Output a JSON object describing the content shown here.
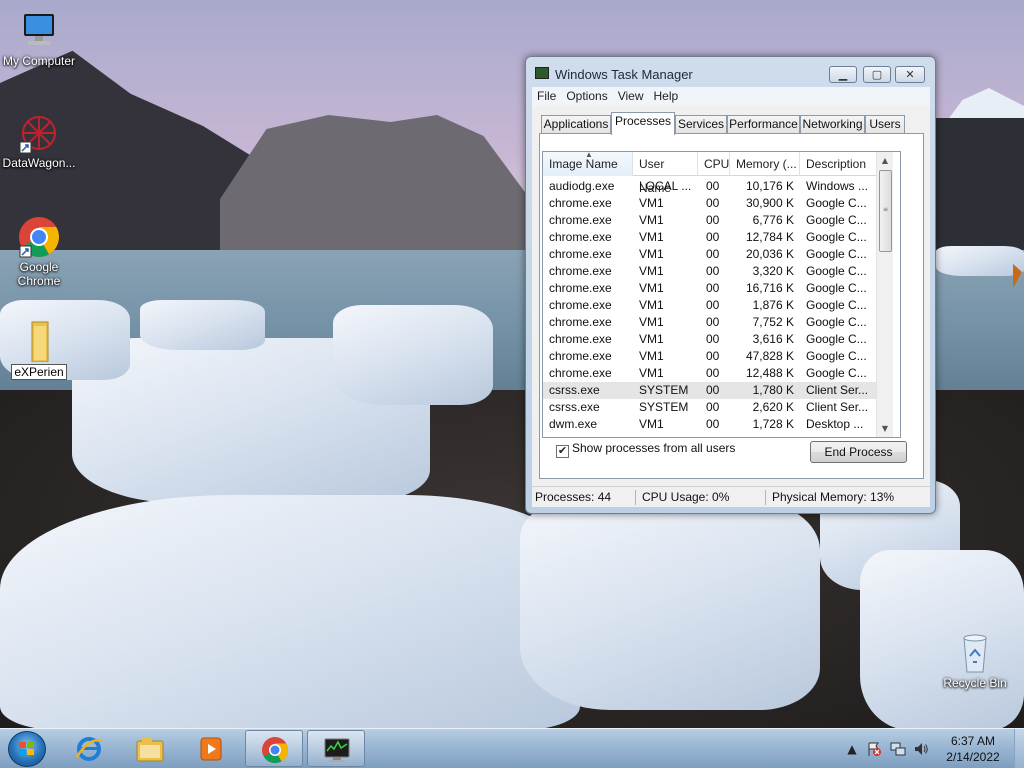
{
  "desktop": {
    "icons": [
      {
        "label": "My Computer",
        "icon": "computer-icon"
      },
      {
        "label": "DataWagon...",
        "icon": "datawagon-icon"
      },
      {
        "label": "Google Chrome",
        "icon": "chrome-icon"
      },
      {
        "label": "eXPerien",
        "icon": "folder-icon"
      },
      {
        "label": "Recycle Bin",
        "icon": "recycle-bin-icon"
      }
    ]
  },
  "window": {
    "title": "Windows Task Manager",
    "controls": {
      "minimize": "▁",
      "maximize": "▢",
      "close": "✕"
    },
    "menu": [
      "File",
      "Options",
      "View",
      "Help"
    ],
    "tabs": [
      "Applications",
      "Processes",
      "Services",
      "Performance",
      "Networking",
      "Users"
    ],
    "active_tab": "Processes",
    "columns": [
      "Image Name",
      "User Name",
      "CPU",
      "Memory (...",
      "Description"
    ],
    "processes": [
      {
        "name": "audiodg.exe",
        "user": "LOCAL ...",
        "cpu": "00",
        "memory": "10,176 K",
        "description": "Windows ..."
      },
      {
        "name": "chrome.exe",
        "user": "VM1",
        "cpu": "00",
        "memory": "30,900 K",
        "description": "Google C..."
      },
      {
        "name": "chrome.exe",
        "user": "VM1",
        "cpu": "00",
        "memory": "6,776 K",
        "description": "Google C..."
      },
      {
        "name": "chrome.exe",
        "user": "VM1",
        "cpu": "00",
        "memory": "12,784 K",
        "description": "Google C..."
      },
      {
        "name": "chrome.exe",
        "user": "VM1",
        "cpu": "00",
        "memory": "20,036 K",
        "description": "Google C..."
      },
      {
        "name": "chrome.exe",
        "user": "VM1",
        "cpu": "00",
        "memory": "3,320 K",
        "description": "Google C..."
      },
      {
        "name": "chrome.exe",
        "user": "VM1",
        "cpu": "00",
        "memory": "16,716 K",
        "description": "Google C..."
      },
      {
        "name": "chrome.exe",
        "user": "VM1",
        "cpu": "00",
        "memory": "1,876 K",
        "description": "Google C..."
      },
      {
        "name": "chrome.exe",
        "user": "VM1",
        "cpu": "00",
        "memory": "7,752 K",
        "description": "Google C..."
      },
      {
        "name": "chrome.exe",
        "user": "VM1",
        "cpu": "00",
        "memory": "3,616 K",
        "description": "Google C..."
      },
      {
        "name": "chrome.exe",
        "user": "VM1",
        "cpu": "00",
        "memory": "47,828 K",
        "description": "Google C..."
      },
      {
        "name": "chrome.exe",
        "user": "VM1",
        "cpu": "00",
        "memory": "12,488 K",
        "description": "Google C..."
      },
      {
        "name": "csrss.exe",
        "user": "SYSTEM",
        "cpu": "00",
        "memory": "1,780 K",
        "description": "Client Ser..."
      },
      {
        "name": "csrss.exe",
        "user": "SYSTEM",
        "cpu": "00",
        "memory": "2,620 K",
        "description": "Client Ser..."
      },
      {
        "name": "dwm.exe",
        "user": "VM1",
        "cpu": "00",
        "memory": "1,728 K",
        "description": "Desktop ..."
      }
    ],
    "selected_row": 12,
    "show_all_users": {
      "label": "Show processes from all users",
      "checked": true
    },
    "end_process_label": "End Process",
    "status": {
      "processes": "Processes: 44",
      "cpu": "CPU Usage: 0%",
      "memory": "Physical Memory: 13%"
    }
  },
  "taskbar": {
    "pinned": [
      "start-orb",
      "internet-explorer-icon",
      "windows-explorer-icon",
      "media-player-icon",
      "chrome-icon",
      "task-manager-icon"
    ],
    "tray_icons": [
      "show-hidden-icons",
      "action-center-flag-icon",
      "network-icon",
      "volume-icon"
    ],
    "clock_time": "6:37 AM",
    "clock_date": "2/14/2022"
  },
  "colors": {
    "accent": "#2773b8",
    "window_frame": "#bcd0e6"
  }
}
